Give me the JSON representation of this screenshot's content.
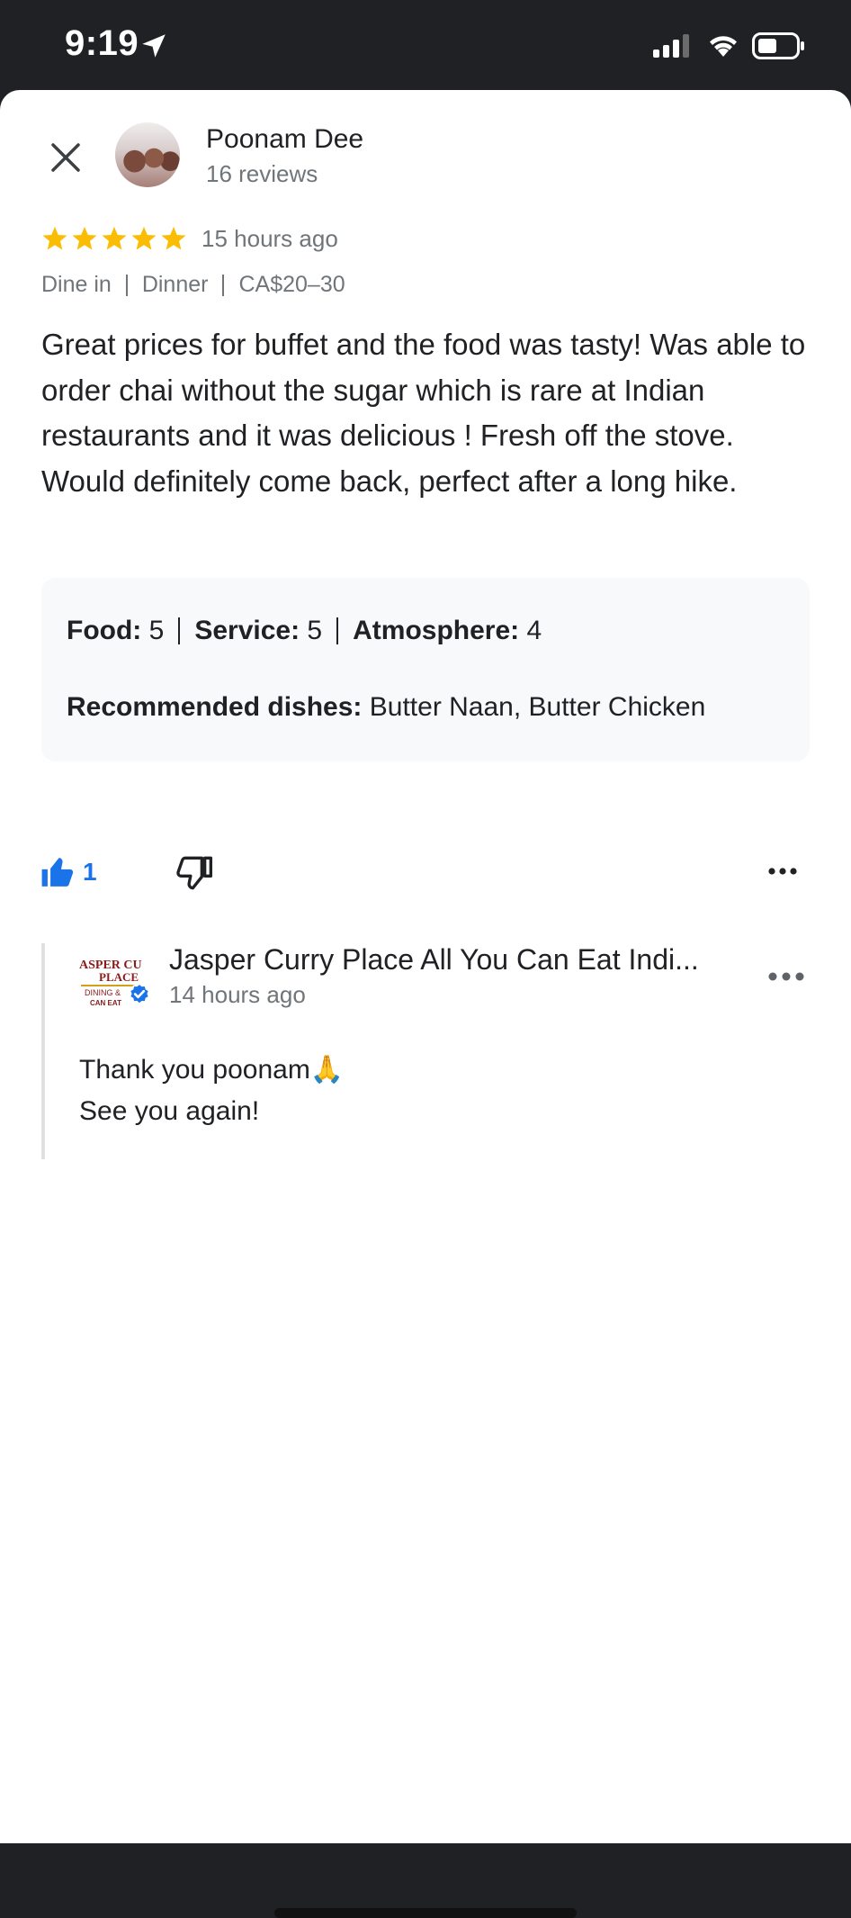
{
  "status_bar": {
    "time": "9:19"
  },
  "reviewer": {
    "name": "Poonam Dee",
    "reviews": "16 reviews"
  },
  "review": {
    "rating": 5,
    "time": "15 hours ago",
    "meta": [
      "Dine in",
      "Dinner",
      "CA$20–30"
    ],
    "text": "Great prices for buffet and the food was tasty! Was able to order chai without the sugar which is rare at Indian restaurants and it was delicious ! Fresh off the stove. Would definitely come back, perfect after a long hike."
  },
  "ratings": {
    "food_label": "Food:",
    "food_value": "5",
    "service_label": "Service:",
    "service_value": "5",
    "atmosphere_label": "Atmosphere:",
    "atmosphere_value": "4",
    "recommended_label": "Recommended dishes:",
    "recommended_value": "Butter Naan, Butter Chicken"
  },
  "actions": {
    "like_count": "1"
  },
  "owner": {
    "name": "Jasper Curry Place All You Can Eat Indi...",
    "time": "14 hours ago",
    "reply_line1": "Thank you poonam",
    "reply_emoji": "🙏",
    "reply_line2": "See you again!",
    "logo_text_top": "ASPER CU",
    "logo_text_mid": "PLACE",
    "logo_text_bottom": "DINING &",
    "logo_text_last": "CAN EAT"
  },
  "colors": {
    "star": "#fbbc04",
    "accent": "#1a73e8",
    "status_bg": "#202124"
  },
  "icons": [
    "location-arrow-icon",
    "signal-icon",
    "wifi-icon",
    "battery-icon",
    "close-icon",
    "star-icon",
    "thumbs-up-icon",
    "thumbs-down-icon",
    "more-icon",
    "verified-icon"
  ]
}
